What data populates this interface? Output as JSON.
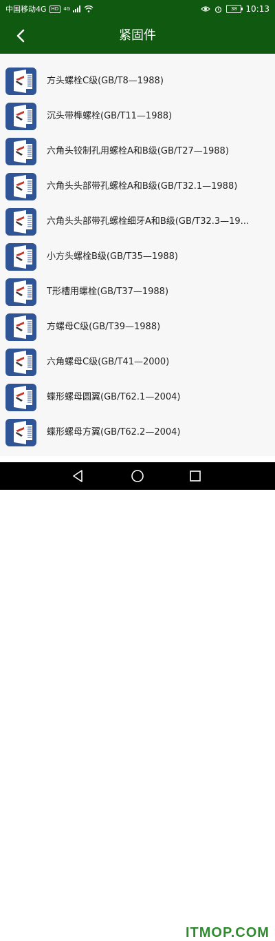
{
  "statusbar": {
    "carrier": "中国移动4G",
    "hd_badge": "HD",
    "network": "4G",
    "battery": "38",
    "time": "10:13"
  },
  "appbar": {
    "title": "紧固件"
  },
  "items": [
    {
      "label": "方头螺栓C级(GB/T8—1988)"
    },
    {
      "label": "沉头带榫螺栓(GB/T11—1988)"
    },
    {
      "label": "六角头铰制孔用螺栓A和B级(GB/T27—1988)"
    },
    {
      "label": "六角头头部带孔螺栓A和B级(GB/T32.1—1988)"
    },
    {
      "label": "六角头头部带孔螺栓细牙A和B级(GB/T32.3—19..."
    },
    {
      "label": "小方头螺栓B级(GB/T35—1988)"
    },
    {
      "label": "T形槽用螺栓(GB/T37—1988)"
    },
    {
      "label": "方螺母C级(GB/T39—1988)"
    },
    {
      "label": "六角螺母C级(GB/T41—2000)"
    },
    {
      "label": "蝶形螺母圆翼(GB/T62.1—2004)"
    },
    {
      "label": "蝶形螺母方翼(GB/T62.2—2004)"
    }
  ],
  "watermark": "ITMOP.COM",
  "colors": {
    "header": "#0f5a10",
    "icon_bg": "#2f5597",
    "text": "#222222"
  }
}
